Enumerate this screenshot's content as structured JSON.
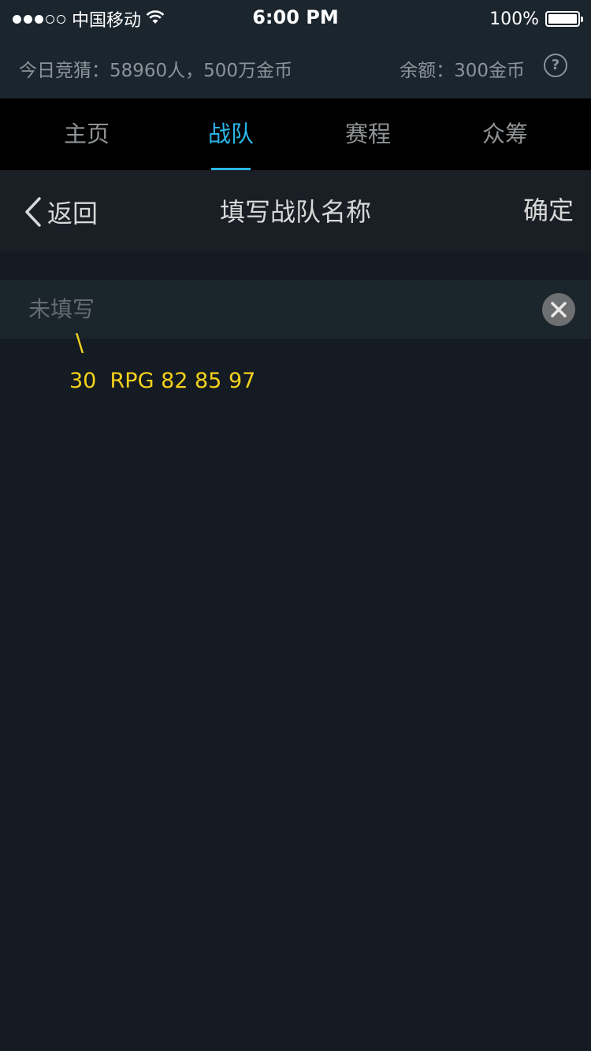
{
  "status_bar": {
    "carrier": "中国移动",
    "time": "6:00 PM",
    "battery": "100%",
    "battery_level": 1.0,
    "signal_strength": 3,
    "signal_max": 5
  },
  "info_bar": {
    "today_guess": "今日竞猜：58960人，500万金币",
    "balance": "余额：300金币",
    "help_symbol": "?"
  },
  "nav_tabs": [
    {
      "label": "主页",
      "active": false
    },
    {
      "label": "战队",
      "active": true
    },
    {
      "label": "赛程",
      "active": false
    },
    {
      "label": "众筹",
      "active": false
    }
  ],
  "header": {
    "back_label": "返回",
    "title": "填写战队名称",
    "confirm_label": "确定"
  },
  "input": {
    "value": "",
    "placeholder": "未填写"
  },
  "annotation": {
    "slash": "\\",
    "text": "30  RPG 82 85 97"
  },
  "colors": {
    "accent": "#29b6e7",
    "annotation": "#f5d21c",
    "background": "#151b22"
  },
  "icons": {
    "wifi": "wifi-icon",
    "battery": "battery-icon",
    "help": "help-icon",
    "back": "chevron-left-icon",
    "clear": "close-icon"
  }
}
